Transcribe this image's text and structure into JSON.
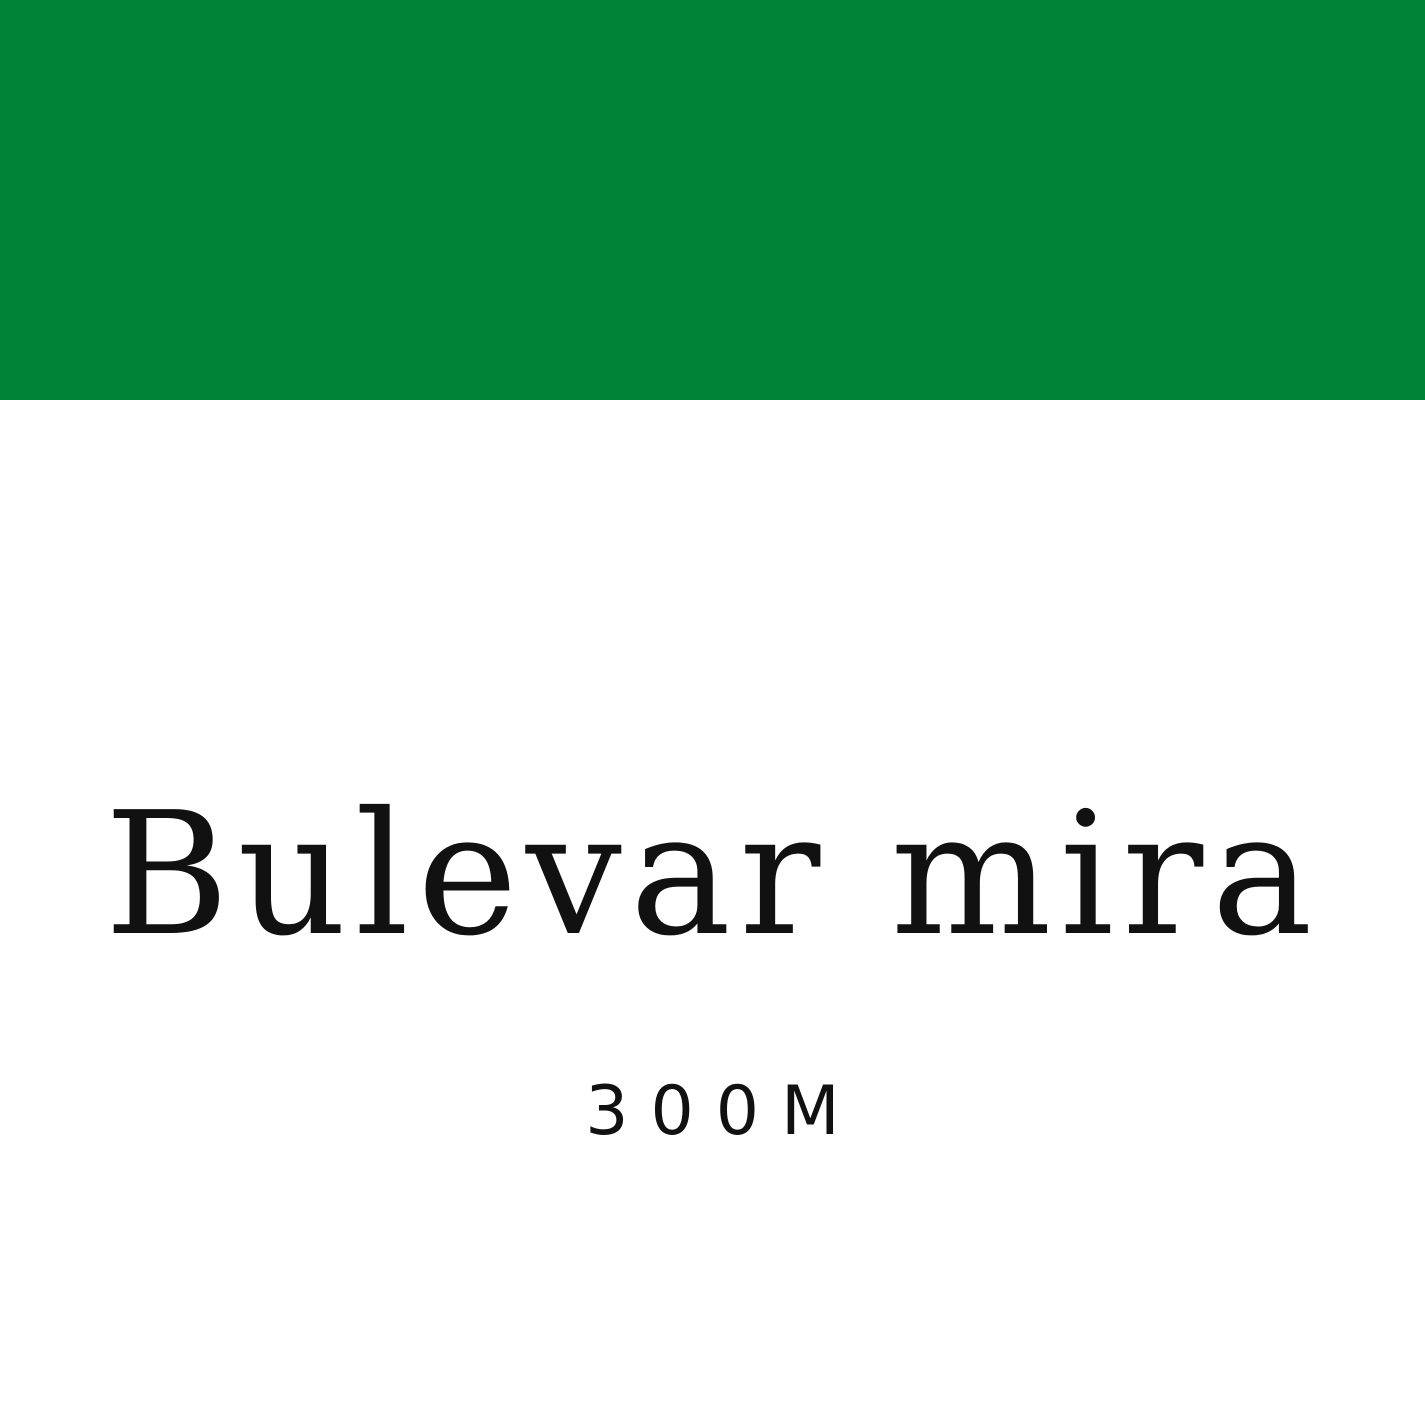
{
  "sign": {
    "band_color": "#008237",
    "background_color": "#ffffff",
    "text_color": "#111111",
    "title": "Bulevar mira",
    "distance": "300M"
  }
}
